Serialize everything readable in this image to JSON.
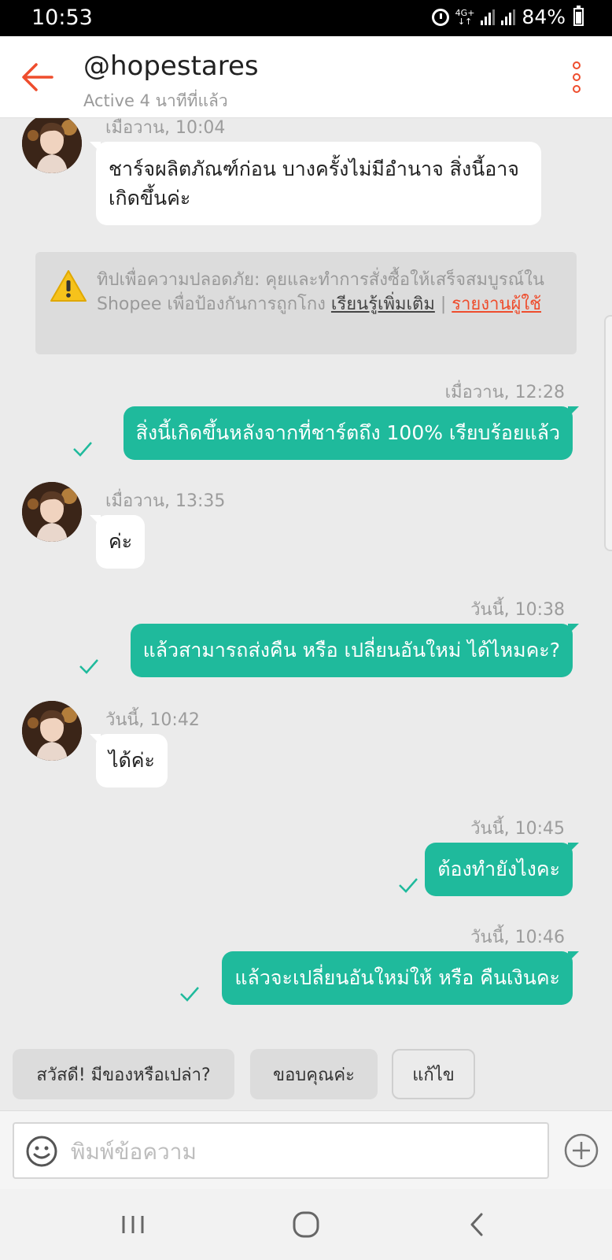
{
  "status_bar": {
    "time": "10:53",
    "network": "4G+",
    "battery": "84%"
  },
  "header": {
    "title": "@hopestares",
    "subtitle": "Active 4 นาทีที่แล้ว",
    "back_icon": "arrow-left-icon",
    "menu_icon": "more-vertical-icon",
    "accent_color": "#ee4d2d"
  },
  "messages": [
    {
      "direction": "in",
      "time": "เมื่อวาน, 10:04",
      "text": "ชาร์จผลิตภัณฑ์ก่อน บางครั้งไม่มีอำนาจ สิ่งนี้อาจเกิดขึ้นค่ะ"
    },
    {
      "direction": "out",
      "time": "เมื่อวาน, 12:28",
      "text": "สิ่งนี้เกิดขึ้นหลังจากที่ชาร์ตถึง 100% เรียบร้อยแล้ว"
    },
    {
      "direction": "in",
      "time": "เมื่อวาน, 13:35",
      "text": "ค่ะ"
    },
    {
      "direction": "out",
      "time": "วันนี้, 10:38",
      "text": "แล้วสามารถส่งคืน หรือ เปลี่ยนอันใหม่ ได้ไหมคะ?"
    },
    {
      "direction": "in",
      "time": "วันนี้, 10:42",
      "text": "ได้ค่ะ"
    },
    {
      "direction": "out",
      "time": "วันนี้, 10:45",
      "text": "ต้องทำยังไงคะ"
    },
    {
      "direction": "out",
      "time": "วันนี้, 10:46",
      "text": "แล้วจะเปลี่ยนอันใหม่ให้ หรือ คืนเงินคะ"
    }
  ],
  "safety_tip": {
    "text": "ทิปเพื่อความปลอดภัย: คุยและทำการสั่งซื้อให้เสร็จสมบูรณ์ใน Shopee เพื่อป้องกันการถูกโกง ",
    "learn_more": "เรียนรู้เพิ่มเติม",
    "separator": "|",
    "report": "รายงานผู้ใช้",
    "icon": "warning-icon"
  },
  "quick_replies": [
    "สวัสดี! มีของหรือเปล่า?",
    "ขอบคุณค่ะ",
    "แก้ไข"
  ],
  "composer": {
    "placeholder": "พิมพ์ข้อความ",
    "emoji_icon": "emoji-icon",
    "add_icon": "plus-circle-icon"
  },
  "colors": {
    "outgoing_bubble": "#1fba9c",
    "incoming_bubble": "#ffffff",
    "background": "#ebebeb"
  }
}
